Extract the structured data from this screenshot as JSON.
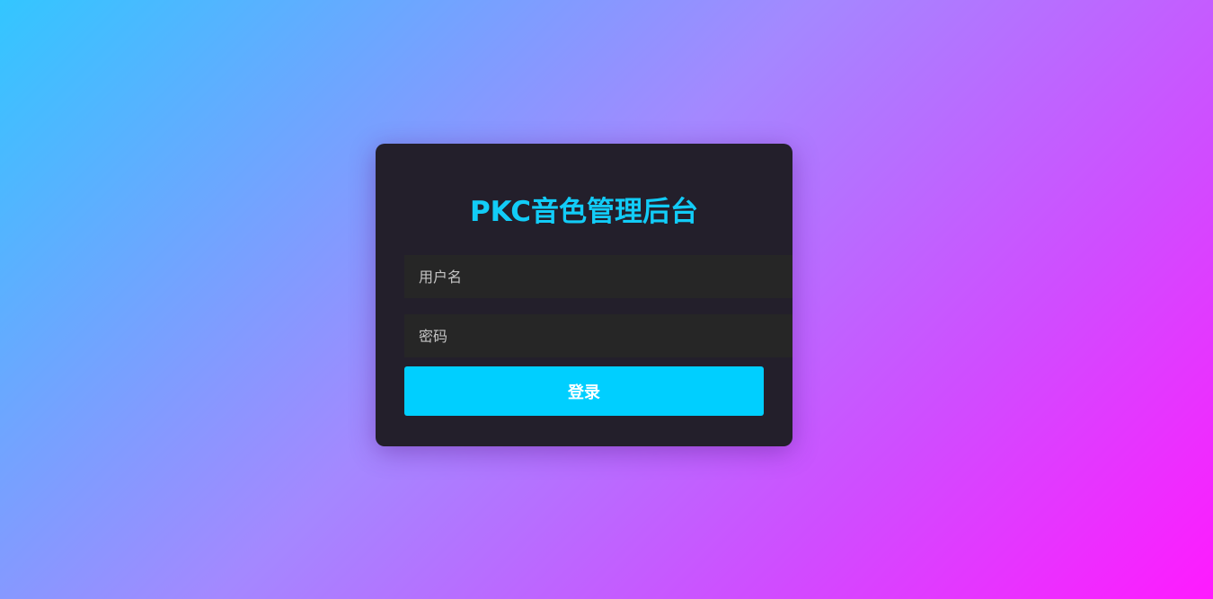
{
  "login": {
    "title": "PKC音色管理后台",
    "username_placeholder": "用户名",
    "password_placeholder": "密码",
    "submit_label": "登录"
  },
  "colors": {
    "accent": "#00cfff",
    "title": "#12ccf7",
    "card_background": "#231f2b",
    "field_background": "#262626",
    "gradient_start": "#33c6ff",
    "gradient_end": "#ff1aff"
  }
}
